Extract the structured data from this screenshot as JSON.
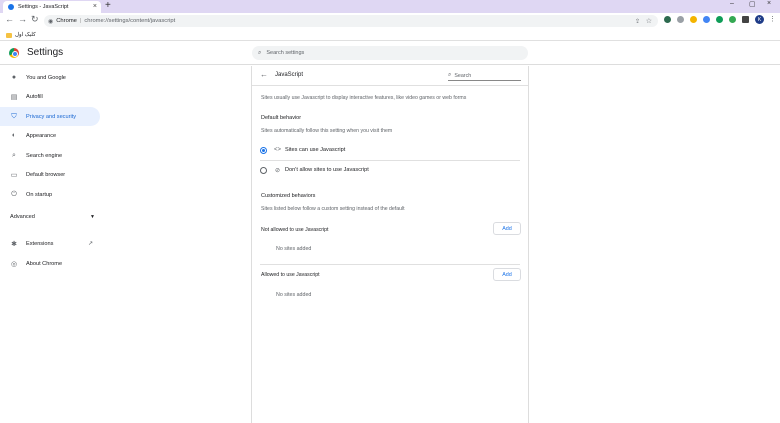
{
  "browser": {
    "tab_title": "Settings - JavaScript",
    "new_tab": "+",
    "omnibox_site": "Chrome",
    "omnibox_url": "chrome://settings/content/javascript",
    "profile_letter": "K",
    "bookmark_folder": "کلیک اول"
  },
  "header": {
    "title": "Settings",
    "search_placeholder": "Search settings"
  },
  "sidebar": {
    "items": [
      {
        "label": "You and Google",
        "icon": "person-icon"
      },
      {
        "label": "Autofill",
        "icon": "clipboard-icon"
      },
      {
        "label": "Privacy and security",
        "icon": "shield-icon"
      },
      {
        "label": "Appearance",
        "icon": "palette-icon"
      },
      {
        "label": "Search engine",
        "icon": "search-icon"
      },
      {
        "label": "Default browser",
        "icon": "browser-icon"
      },
      {
        "label": "On startup",
        "icon": "power-icon"
      }
    ],
    "advanced": "Advanced",
    "extensions": "Extensions",
    "about": "About Chrome"
  },
  "panel": {
    "title": "JavaScript",
    "search_placeholder": "Search",
    "intro": "Sites usually use Javascript to display interactive features, like video games or web forms",
    "default_behavior": "Default behavior",
    "default_desc": "Sites automatically follow this setting when you visit them",
    "option_allow": "Sites can use Javascript",
    "option_block": "Don't allow sites to use Javascript",
    "customized": "Customized behaviors",
    "customized_desc": "Sites listed below follow a custom setting instead of the default",
    "not_allowed_label": "Not allowed to use Javascript",
    "allowed_label": "Allowed to use Javascript",
    "add_label": "Add",
    "no_sites": "No sites added"
  },
  "colors": {
    "accent": "#1a73e8",
    "tabstrip": "#dfd7f3",
    "active_nav_bg": "#e8f0fe"
  }
}
